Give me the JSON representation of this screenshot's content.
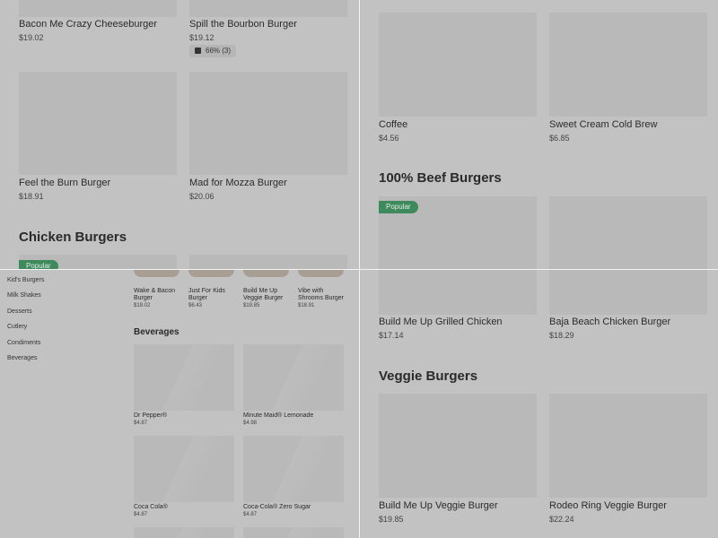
{
  "top_left": {
    "items_row1": [
      {
        "name": "Bacon Me Crazy Cheeseburger",
        "price": "$19.02"
      },
      {
        "name": "Spill the Bourbon Burger",
        "price": "$19.12"
      }
    ],
    "rating": "66% (3)",
    "items_row2": [
      {
        "name": "Feel the Burn Burger",
        "price": "$18.91"
      },
      {
        "name": "Mad for Mozza Burger",
        "price": "$20.06"
      }
    ],
    "section_title": "Chicken Burgers",
    "badge": "Popular"
  },
  "top_right": {
    "items_row1": [
      {
        "name": "Coffee",
        "price": "$4.56"
      },
      {
        "name": "Sweet Cream Cold Brew",
        "price": "$6.85"
      }
    ],
    "section_title": "100% Beef Burgers",
    "badge": "Popular"
  },
  "bottom_left": {
    "sidebar": [
      "Kid's Burgers",
      "Milk Shakes",
      "Desserts",
      "Cutlery",
      "Condiments",
      "Beverages"
    ],
    "carousel": [
      {
        "name": "Wake & Bacon Burger",
        "price": "$19.02"
      },
      {
        "name": "Just For Kids Burger",
        "price": "$6.43"
      },
      {
        "name": "Build Me Up Veggie Burger",
        "price": "$19.85"
      },
      {
        "name": "Vibe with Shrooms Burger",
        "price": "$18.91"
      }
    ],
    "section_title": "Beverages",
    "beverages": [
      {
        "name": "Dr Pepper®",
        "price": "$4.87"
      },
      {
        "name": "Minute Maid® Lemonade",
        "price": "$4.98"
      },
      {
        "name": "Coca Cola®",
        "price": "$4.87"
      },
      {
        "name": "Coca-Cola® Zero Sugar",
        "price": "$4.87"
      }
    ]
  },
  "bottom_right": {
    "items_row1": [
      {
        "name": "Build Me Up Grilled Chicken",
        "price": "$17.14"
      },
      {
        "name": "Baja Beach Chicken Burger",
        "price": "$18.29"
      }
    ],
    "section_title": "Veggie Burgers",
    "items_row2": [
      {
        "name": "Build Me Up Veggie Burger",
        "price": "$19.85"
      },
      {
        "name": "Rodeo Ring Veggie Burger",
        "price": "$22.24"
      }
    ]
  }
}
